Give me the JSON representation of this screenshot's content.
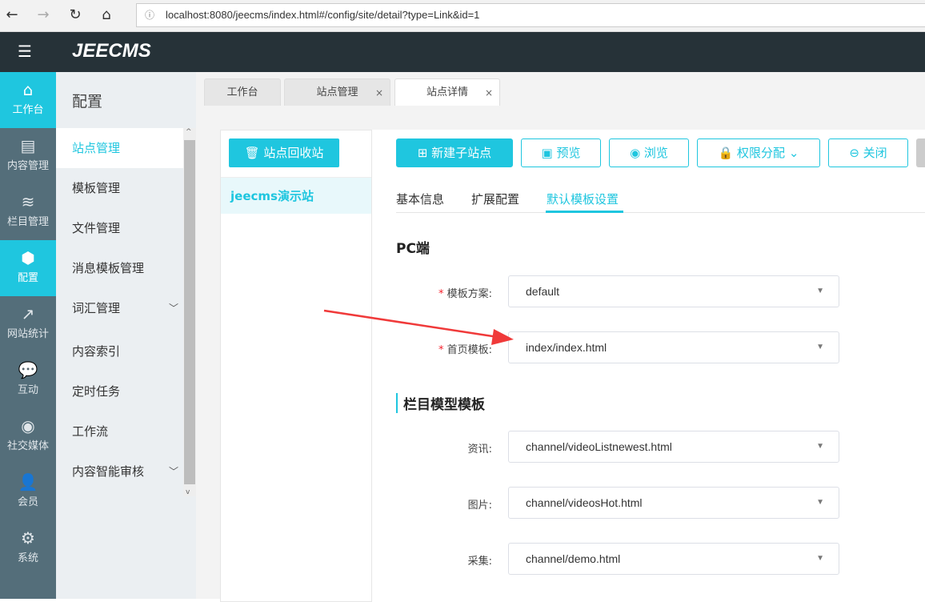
{
  "browser": {
    "url": "localhost:8080/jeecms/index.html#/config/site/detail?type=Link&id=1"
  },
  "header": {
    "logo": "JEECMS"
  },
  "iconbar": [
    {
      "label": "工作台",
      "icon": "⌂"
    },
    {
      "label": "内容管理",
      "icon": "▤"
    },
    {
      "label": "栏目管理",
      "icon": "≋"
    },
    {
      "label": "配置",
      "icon": "⬢"
    },
    {
      "label": "网站统计",
      "icon": "↗"
    },
    {
      "label": "互动",
      "icon": "💬"
    },
    {
      "label": "社交媒体",
      "icon": "◉"
    },
    {
      "label": "会员",
      "icon": "👤"
    },
    {
      "label": "系统",
      "icon": "⚙"
    }
  ],
  "menu": {
    "title": "配置",
    "items": [
      "站点管理",
      "模板管理",
      "文件管理",
      "消息模板管理",
      "词汇管理",
      "内容索引",
      "定时任务",
      "工作流",
      "内容智能审核"
    ]
  },
  "tabs": [
    {
      "label": "工作台"
    },
    {
      "label": "站点管理",
      "close": "×"
    },
    {
      "label": "站点详情",
      "close": "×"
    }
  ],
  "left": {
    "recycle": "站点回收站",
    "site": "jeecms演示站"
  },
  "toolbar": {
    "new": "新建子站点",
    "preview": "预览",
    "browse": "浏览",
    "perm": "权限分配",
    "close": "关闭"
  },
  "subtabs": [
    "基本信息",
    "扩展配置",
    "默认模板设置"
  ],
  "pc": {
    "title": "PC端",
    "fields": [
      {
        "label": "模板方案:",
        "value": "default"
      },
      {
        "label": "首页模板:",
        "value": "index/index.html"
      }
    ]
  },
  "channel": {
    "title": "栏目模型模板",
    "fields": [
      {
        "label": "资讯:",
        "value": "channel/videoListnewest.html"
      },
      {
        "label": "图片:",
        "value": "channel/videosHot.html"
      },
      {
        "label": "采集:",
        "value": "channel/demo.html"
      }
    ]
  },
  "colors": {
    "accent": "#1fc6df",
    "annotation": "#f03a3a"
  }
}
